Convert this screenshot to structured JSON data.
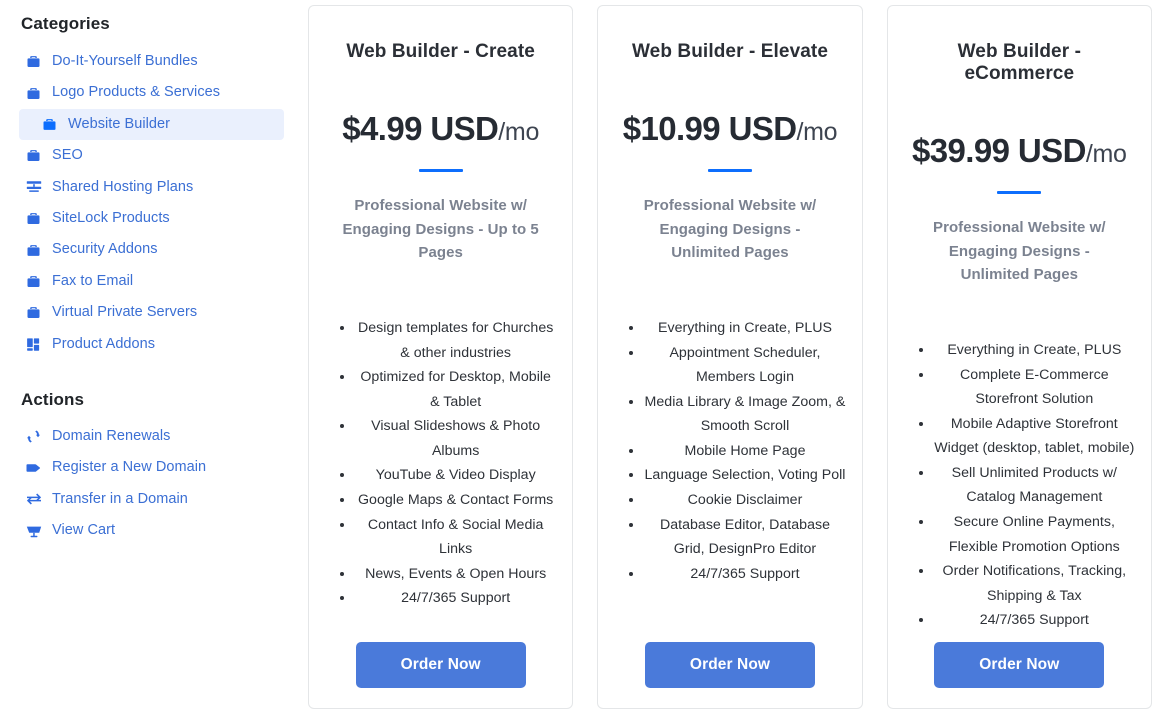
{
  "sidebar": {
    "categories_heading": "Categories",
    "actions_heading": "Actions",
    "categories": [
      {
        "label": "Do-It-Yourself Bundles",
        "icon": "briefcase-icon",
        "active": false
      },
      {
        "label": "Logo Products & Services",
        "icon": "briefcase-icon",
        "active": false
      },
      {
        "label": "Website Builder",
        "icon": "briefcase-icon",
        "active": true
      },
      {
        "label": "SEO",
        "icon": "briefcase-icon",
        "active": false
      },
      {
        "label": "Shared Hosting Plans",
        "icon": "server-icon",
        "active": false
      },
      {
        "label": "SiteLock Products",
        "icon": "briefcase-icon",
        "active": false
      },
      {
        "label": "Security Addons",
        "icon": "briefcase-icon",
        "active": false
      },
      {
        "label": "Fax to Email",
        "icon": "briefcase-icon",
        "active": false
      },
      {
        "label": "Virtual Private Servers",
        "icon": "briefcase-icon",
        "active": false
      },
      {
        "label": "Product Addons",
        "icon": "layers-icon",
        "active": false
      }
    ],
    "actions": [
      {
        "label": "Domain Renewals",
        "icon": "sync-icon"
      },
      {
        "label": "Register a New Domain",
        "icon": "tag-icon"
      },
      {
        "label": "Transfer in a Domain",
        "icon": "exchange-arrows-icon"
      },
      {
        "label": "View Cart",
        "icon": "shopping-cart-icon"
      }
    ]
  },
  "colors": {
    "accent_blue": "#0d6efd",
    "link_blue": "#3b6fd4",
    "button_blue": "#4a7ada",
    "active_bg": "#eaf0fd",
    "card_border": "#e4e6e8",
    "tagline_gray": "#7b8290",
    "heading_dark": "#212529"
  },
  "cards": [
    {
      "title": "Web Builder - Create",
      "price_amount": "$4.99 USD",
      "price_period": "/mo",
      "tagline": "Professional Website w/ Engaging Designs - Up to 5 Pages",
      "features": [
        "Design templates for Churches & other industries",
        "Optimized for Desktop, Mobile & Tablet",
        "Visual Slideshows & Photo Albums",
        "YouTube & Video Display",
        "Google Maps & Contact Forms",
        "Contact Info & Social Media Links",
        "News, Events & Open Hours",
        "24/7/365 Support"
      ],
      "order_label": "Order Now"
    },
    {
      "title": "Web Builder - Elevate",
      "price_amount": "$10.99 USD",
      "price_period": "/mo",
      "tagline": "Professional Website w/ Engaging Designs - Unlimited Pages",
      "features": [
        "Everything in Create, PLUS",
        "Appointment Scheduler, Members Login",
        "Media Library & Image Zoom, & Smooth Scroll",
        "Mobile Home Page",
        "Language Selection, Voting Poll",
        "Cookie Disclaimer",
        "Database Editor, Database Grid, DesignPro Editor",
        "24/7/365 Support"
      ],
      "order_label": "Order Now"
    },
    {
      "title": "Web Builder - eCommerce",
      "price_amount": "$39.99 USD",
      "price_period": "/mo",
      "tagline": "Professional Website w/ Engaging Designs - Unlimited Pages",
      "features": [
        "Everything in Create, PLUS",
        "Complete E-Commerce Storefront Solution",
        "Mobile Adaptive Storefront Widget (desktop, tablet, mobile)",
        "Sell Unlimited Products w/ Catalog Management",
        "Secure Online Payments, Flexible Promotion Options",
        "Order Notifications, Tracking, Shipping & Tax",
        "24/7/365 Support"
      ],
      "order_label": "Order Now"
    }
  ]
}
